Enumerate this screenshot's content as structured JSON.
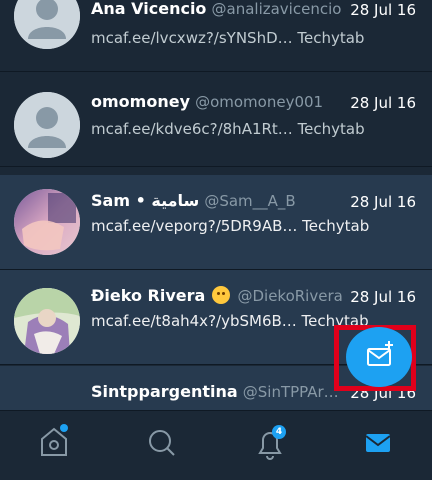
{
  "conversations": [
    {
      "name": "Ana Vicencio",
      "handle": "@analizavicencio",
      "date": "28 Jul 16",
      "message": "mcaf.ee/lvcxwz?/sYNShD… Techytab",
      "unread": false
    },
    {
      "name": "omomoney",
      "handle": "@omomoney001",
      "date": "28 Jul 16",
      "message": "mcaf.ee/kdve6c?/8hA1Rt… Techytab",
      "unread": false
    },
    {
      "name": "Sam • سامية",
      "handle": "@Sam__A_B",
      "date": "28 Jul 16",
      "message": "mcaf.ee/veporg?/5DR9AB… Techytab",
      "unread": true
    },
    {
      "name": "Ðieko Rivera",
      "handle": "@DiekoRivera",
      "date": "28 Jul 16",
      "message": "mcaf.ee/t8ah4x?/ybSM6B… Techytab",
      "unread": true
    },
    {
      "name": "Sintppargentina",
      "handle": "@SinTPPAr…",
      "date": "28 Jul 16",
      "message": "",
      "unread": true
    }
  ],
  "nav": {
    "notifications_badge": "4"
  },
  "icons": {
    "home": "home-icon",
    "search": "search-icon",
    "notifications": "bell-icon",
    "messages": "envelope-icon",
    "compose": "new-message-icon"
  },
  "colors": {
    "accent": "#1da1f2",
    "background": "#1b2836",
    "unread_row": "#273a4f",
    "highlight": "#e0001b"
  }
}
